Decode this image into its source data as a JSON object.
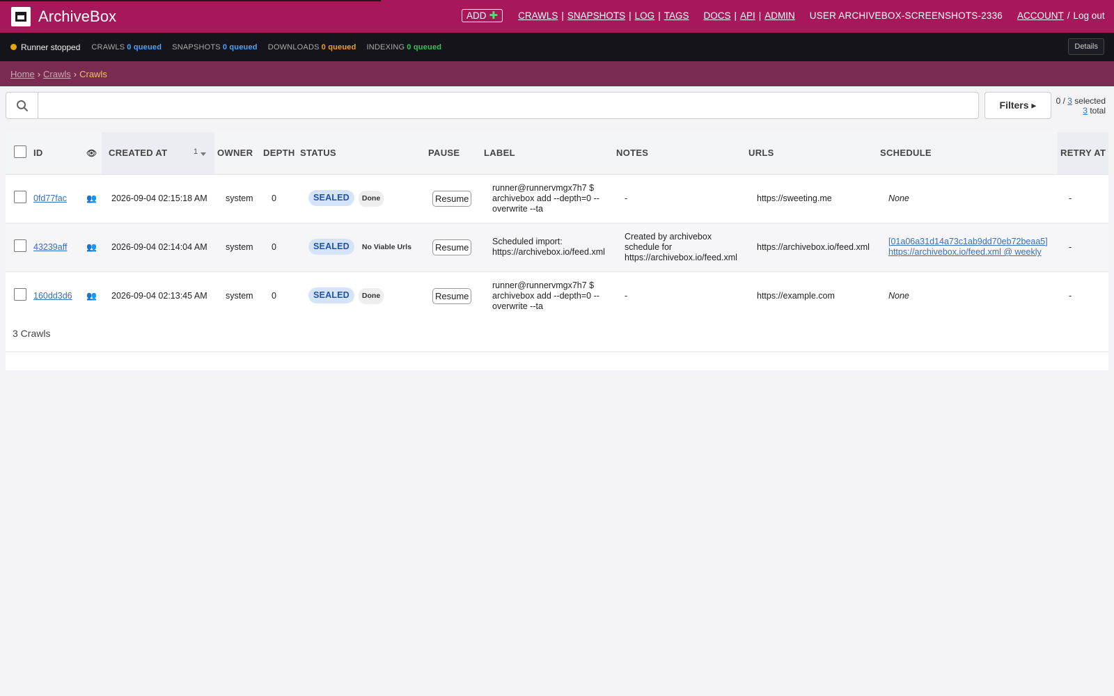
{
  "header": {
    "brand": "ArchiveBox",
    "add_label": "ADD",
    "nav": {
      "crawls": "CRAWLS",
      "snapshots": "SNAPSHOTS",
      "log": "LOG",
      "tags": "TAGS",
      "docs": "DOCS",
      "api": "API",
      "admin": "ADMIN",
      "sep": "|",
      "user": "USER ARCHIVEBOX-SCREENSHOTS-2336",
      "account": "ACCOUNT",
      "slash": "/",
      "logout": "Log out"
    }
  },
  "statusbar": {
    "runner": "Runner stopped",
    "crawls_label": "CRAWLS",
    "crawls_value": "0 queued",
    "snapshots_label": "SNAPSHOTS",
    "snapshots_value": "0 queued",
    "downloads_label": "DOWNLOADS",
    "downloads_value": "0 queued",
    "indexing_label": "INDEXING",
    "indexing_value": "0 queued",
    "details": "Details"
  },
  "breadcrumb": {
    "home": "Home",
    "crawls": "Crawls",
    "current": "Crawls",
    "sep": "›"
  },
  "search": {
    "placeholder": "",
    "filters": "Filters ▸",
    "sel_prefix": "0 /",
    "sel_count": "3",
    "sel_suffix": "selected",
    "total_count": "3",
    "total_suffix": "total"
  },
  "table": {
    "headers": {
      "id": "ID",
      "created_at": "CREATED AT",
      "sort_num": "1",
      "owner": "OWNER",
      "depth": "DEPTH",
      "status": "STATUS",
      "pause": "PAUSE",
      "label": "LABEL",
      "notes": "NOTES",
      "urls": "URLS",
      "schedule": "SCHEDULE",
      "retry_at": "RETRY AT"
    },
    "rows": [
      {
        "id": "0fd77fac",
        "created_at": "2026-09-04 02:15:18 AM",
        "owner": "system",
        "depth": "0",
        "status": "SEALED",
        "sub_status": "Done",
        "pause": "Resume",
        "label": "runner@runnervmgx7h7 $ archivebox add --depth=0 --overwrite --ta",
        "notes": "-",
        "urls": "https://sweeting.me",
        "schedule_link1": "",
        "schedule_link2": "",
        "schedule_text": "None",
        "retry_at": "-"
      },
      {
        "id": "43239aff",
        "created_at": "2026-09-04 02:14:04 AM",
        "owner": "system",
        "depth": "0",
        "status": "SEALED",
        "sub_status": "No Viable Urls",
        "pause": "Resume",
        "label": "Scheduled import: https://archivebox.io/feed.xml",
        "notes": "Created by archivebox schedule for https://archivebox.io/feed.xml",
        "urls": "https://archivebox.io/feed.xml",
        "schedule_link1": "[01a06a31d14a73c1ab9dd70eb72beaa5]",
        "schedule_link2": "https://archivebox.io/feed.xml @ weekly",
        "schedule_text": "",
        "retry_at": "-"
      },
      {
        "id": "160dd3d6",
        "created_at": "2026-09-04 02:13:45 AM",
        "owner": "system",
        "depth": "0",
        "status": "SEALED",
        "sub_status": "Done",
        "pause": "Resume",
        "label": "runner@runnervmgx7h7 $ archivebox add --depth=0 --overwrite --ta",
        "notes": "-",
        "urls": "https://example.com",
        "schedule_link1": "",
        "schedule_link2": "",
        "schedule_text": "None",
        "retry_at": "-"
      }
    ],
    "footer": "3 Crawls"
  },
  "colors": {
    "header_bg": "#a7185a",
    "breadcrumb_bg": "#792c4f",
    "status_bg": "#14141a",
    "sealed_badge": "#d6e4fb"
  }
}
